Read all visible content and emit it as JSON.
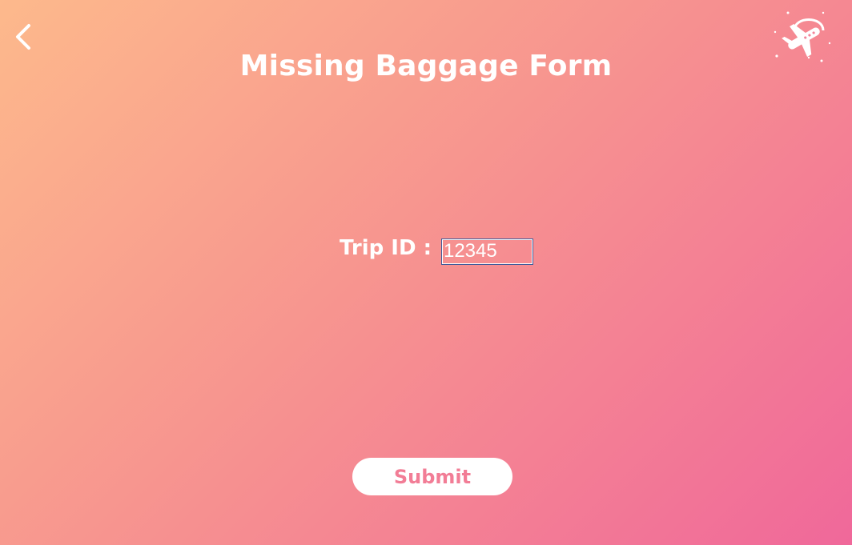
{
  "header": {
    "back_icon": "chevron-left-icon",
    "title": "Missing Baggage Form",
    "logo_icon": "airplane-globe-icon"
  },
  "form": {
    "trip_id_label": "Trip ID :",
    "trip_id_value": "12345",
    "submit_label": "Submit"
  },
  "colors": {
    "gradient_start": "#fdb98c",
    "gradient_end": "#f0689a",
    "submit_text": "#f27d96",
    "input_border": "#3f5b9a"
  }
}
